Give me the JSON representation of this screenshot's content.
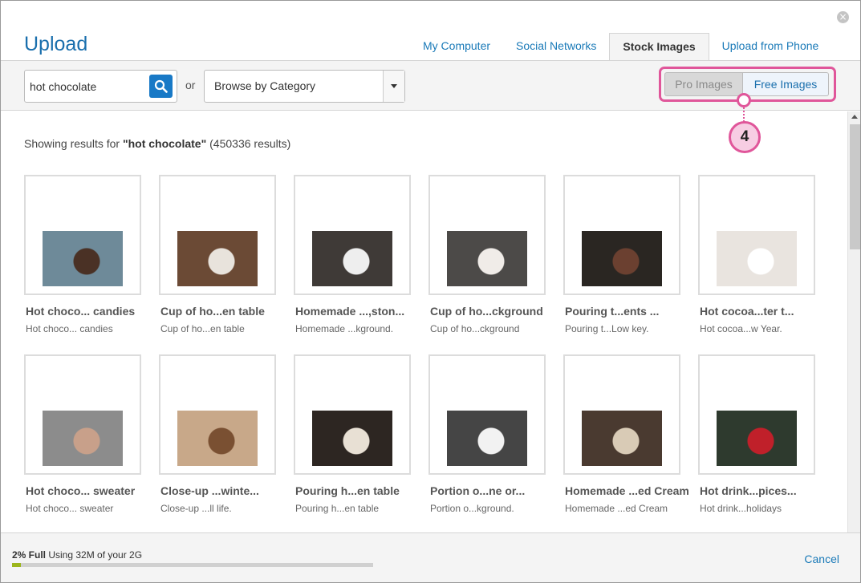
{
  "dialog": {
    "title": "Upload",
    "close_icon": "close-icon"
  },
  "tabs": [
    {
      "label": "My Computer",
      "active": false
    },
    {
      "label": "Social Networks",
      "active": false
    },
    {
      "label": "Stock Images",
      "active": true
    },
    {
      "label": "Upload from Phone",
      "active": false
    }
  ],
  "search": {
    "value": "hot chocolate",
    "button_icon": "search-icon",
    "or_label": "or",
    "category_value": "Browse by Category"
  },
  "image_type": {
    "pro_label": "Pro Images",
    "free_label": "Free Images",
    "selected": "Free Images"
  },
  "callout": {
    "number": "4",
    "color": "#e0569a"
  },
  "results": {
    "prefix": "Showing results for ",
    "query": "\"hot chocolate\"",
    "count": " (450336 results)"
  },
  "images": [
    {
      "title": "Hot choco... candies",
      "subtitle": "Hot choco... candies",
      "colors": [
        "#6e8a99",
        "#4a3125"
      ]
    },
    {
      "title": "Cup of ho...en table",
      "subtitle": "Cup of ho...en table",
      "colors": [
        "#6b4a35",
        "#e8e3dc"
      ]
    },
    {
      "title": "Homemade ...,ston...",
      "subtitle": "Homemade ...kground.",
      "colors": [
        "#3f3a37",
        "#eeeeee"
      ]
    },
    {
      "title": "Cup of ho...ckground",
      "subtitle": "Cup of ho...ckground",
      "colors": [
        "#4c4a48",
        "#f0ece8"
      ]
    },
    {
      "title": "Pouring t...ents ...",
      "subtitle": "Pouring t...Low key.",
      "colors": [
        "#2a2622",
        "#6b4030"
      ]
    },
    {
      "title": "Hot cocoa...ter t...",
      "subtitle": "Hot cocoa...w Year.",
      "colors": [
        "#e9e4df",
        "#ffffff"
      ]
    },
    {
      "title": "Hot choco... sweater",
      "subtitle": "Hot choco... sweater",
      "colors": [
        "#8c8c8c",
        "#c8a08a"
      ]
    },
    {
      "title": "Close-up ...winte...",
      "subtitle": "Close-up ...ll life.",
      "colors": [
        "#c8a889",
        "#7a5032"
      ]
    },
    {
      "title": "Pouring h...en table",
      "subtitle": "Pouring h...en table",
      "colors": [
        "#2d2622",
        "#e8e0d4"
      ]
    },
    {
      "title": "Portion o...ne or...",
      "subtitle": "Portion o...kground.",
      "colors": [
        "#454545",
        "#f2f2f2"
      ]
    },
    {
      "title": "Homemade ...ed Cream",
      "subtitle": "Homemade ...ed Cream",
      "colors": [
        "#4a3a30",
        "#d9cbb6"
      ]
    },
    {
      "title": "Hot drink...pices...",
      "subtitle": "Hot drink...holidays",
      "colors": [
        "#2e3a2e",
        "#c0202a"
      ]
    }
  ],
  "footer": {
    "usage_percent_label": "2% Full",
    "usage_text": " Using 32M of your 2G",
    "usage_fraction": 0.025,
    "usage_color": "#9cb61c",
    "cancel_label": "Cancel"
  }
}
